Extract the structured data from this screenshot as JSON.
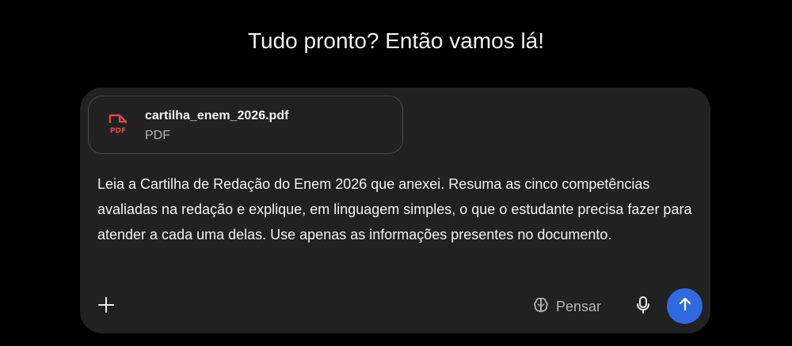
{
  "headline": "Tudo pronto? Então vamos lá!",
  "attachment": {
    "file_name": "cartilha_enem_2026.pdf",
    "file_type": "PDF",
    "icon_label": "PDF",
    "icon": "pdf-file-icon",
    "icon_color": "#e5484d"
  },
  "prompt": {
    "text": "Leia a Cartilha de Redação do Enem 2026 que anexei. Resuma as cinco competências avaliadas na redação e explique, em linguagem simples, o que o estudante precisa fazer para atender a cada uma delas. Use apenas as informações presentes no documento."
  },
  "toolbar": {
    "add_icon": "plus-icon",
    "think_label": "Pensar",
    "think_icon": "brain-icon",
    "mic_icon": "microphone-icon",
    "send_icon": "arrow-up-icon",
    "send_color": "#2f6ae0"
  }
}
